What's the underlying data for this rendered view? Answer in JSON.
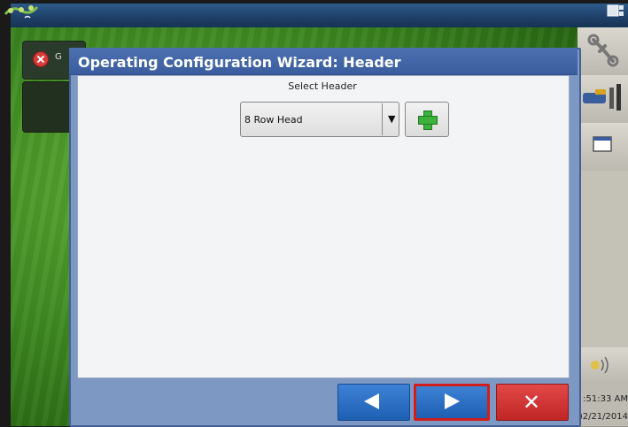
{
  "topbar": {
    "gps_icon": "gps-satellite-icon",
    "screen_icon": "screen-icon"
  },
  "notification": {
    "icon": "error-icon",
    "text_fragment": "G"
  },
  "dialog": {
    "title": "Operating Configuration Wizard:  Header",
    "select_label": "Select Header",
    "header_select": {
      "selected": "8 Row Head",
      "arrow": "▼"
    },
    "add_button": {
      "icon": "plus-icon"
    },
    "buttons": {
      "back": {
        "icon": "arrow-left-icon"
      },
      "next": {
        "icon": "arrow-right-icon"
      },
      "cancel": {
        "icon": "close-icon",
        "glyph": "✕"
      }
    }
  },
  "sidebar": {
    "items": [
      {
        "icon": "wrench-icon"
      },
      {
        "icon": "tools-icon"
      },
      {
        "icon": "window-icon"
      },
      {
        "icon": "sound-icon"
      }
    ],
    "clock": {
      "time": ":51:33 AM",
      "date": ")2/21/2014"
    }
  },
  "colors": {
    "titlebar": "#3a5d9e",
    "nav_button": "#1e5fb2",
    "cancel_button": "#c02626",
    "highlight_border": "#d11d1d",
    "plus_green": "#3cb13c"
  }
}
